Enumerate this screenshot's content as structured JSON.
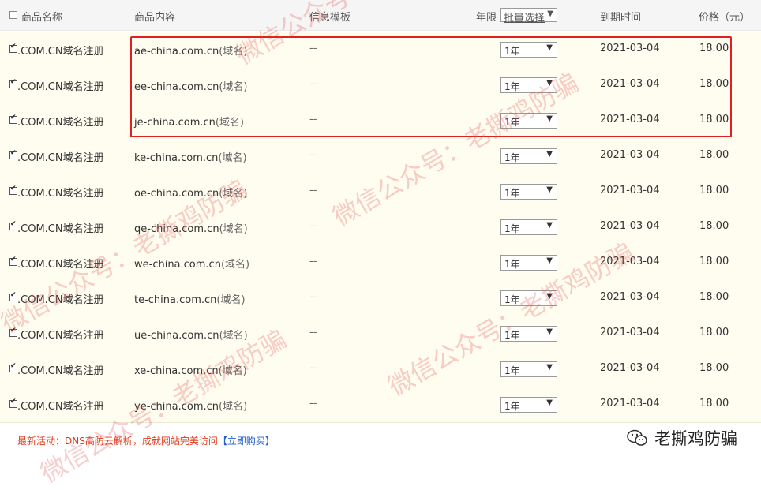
{
  "header": {
    "name_label": "商品名称",
    "content_label": "商品内容",
    "template_label": "信息模板",
    "period_label": "年限",
    "bulk_select_label": "批量选择",
    "expiry_label": "到期时间",
    "price_label": "价格（元）"
  },
  "rows": [
    {
      "name": ".COM.CN域名注册",
      "domain": "ae-china.com.cn",
      "tag": "(域名)",
      "template": "--",
      "period": "1年",
      "expiry": "2021-03-04",
      "price": "18.00"
    },
    {
      "name": ".COM.CN域名注册",
      "domain": "ee-china.com.cn",
      "tag": "(域名)",
      "template": "--",
      "period": "1年",
      "expiry": "2021-03-04",
      "price": "18.00"
    },
    {
      "name": ".COM.CN域名注册",
      "domain": "je-china.com.cn",
      "tag": "(域名)",
      "template": "--",
      "period": "1年",
      "expiry": "2021-03-04",
      "price": "18.00"
    },
    {
      "name": ".COM.CN域名注册",
      "domain": "ke-china.com.cn",
      "tag": "(域名)",
      "template": "--",
      "period": "1年",
      "expiry": "2021-03-04",
      "price": "18.00"
    },
    {
      "name": ".COM.CN域名注册",
      "domain": "oe-china.com.cn",
      "tag": "(域名)",
      "template": "--",
      "period": "1年",
      "expiry": "2021-03-04",
      "price": "18.00"
    },
    {
      "name": ".COM.CN域名注册",
      "domain": "qe-china.com.cn",
      "tag": "(域名)",
      "template": "--",
      "period": "1年",
      "expiry": "2021-03-04",
      "price": "18.00"
    },
    {
      "name": ".COM.CN域名注册",
      "domain": "we-china.com.cn",
      "tag": "(域名)",
      "template": "--",
      "period": "1年",
      "expiry": "2021-03-04",
      "price": "18.00"
    },
    {
      "name": ".COM.CN域名注册",
      "domain": "te-china.com.cn",
      "tag": "(域名)",
      "template": "--",
      "period": "1年",
      "expiry": "2021-03-04",
      "price": "18.00"
    },
    {
      "name": ".COM.CN域名注册",
      "domain": "ue-china.com.cn",
      "tag": "(域名)",
      "template": "--",
      "period": "1年",
      "expiry": "2021-03-04",
      "price": "18.00"
    },
    {
      "name": ".COM.CN域名注册",
      "domain": "xe-china.com.cn",
      "tag": "(域名)",
      "template": "--",
      "period": "1年",
      "expiry": "2021-03-04",
      "price": "18.00"
    },
    {
      "name": ".COM.CN域名注册",
      "domain": "ye-china.com.cn",
      "tag": "(域名)",
      "template": "--",
      "period": "1年",
      "expiry": "2021-03-04",
      "price": "18.00"
    }
  ],
  "footer": {
    "promo_text": "最新活动：DNS高防云解析，成就网站完美访问",
    "promo_link": "【立即购买】",
    "brand_name": "老撕鸡防骗"
  },
  "watermark": {
    "text_account": "微信公众号：老撕鸡防骗",
    "text_short": "微信公众号"
  },
  "colors": {
    "highlight_box": "#e02020",
    "row_background": "#fffdf0",
    "watermark": "#e25050",
    "promo": "#e03a1a",
    "link": "#2660c8"
  }
}
